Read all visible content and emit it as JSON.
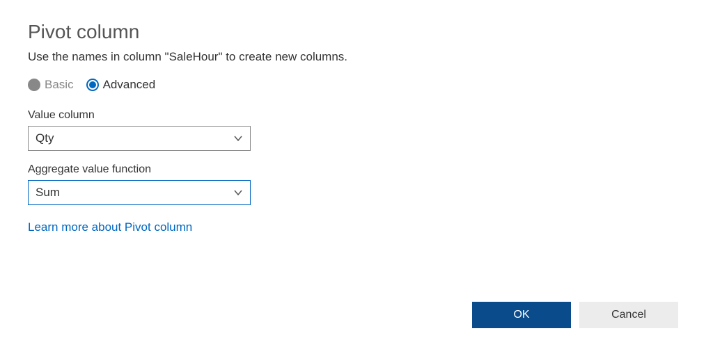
{
  "dialog": {
    "title": "Pivot column",
    "description": "Use the names in column \"SaleHour\" to create new columns."
  },
  "mode": {
    "basic_label": "Basic",
    "advanced_label": "Advanced"
  },
  "fields": {
    "value_column": {
      "label": "Value column",
      "selected": "Qty"
    },
    "aggregate_function": {
      "label": "Aggregate value function",
      "selected": "Sum"
    }
  },
  "learn_more": "Learn more about Pivot column",
  "buttons": {
    "ok": "OK",
    "cancel": "Cancel"
  },
  "colors": {
    "accent": "#0067c0",
    "primary_button": "#0a4b8c",
    "secondary_button": "#ececec"
  }
}
